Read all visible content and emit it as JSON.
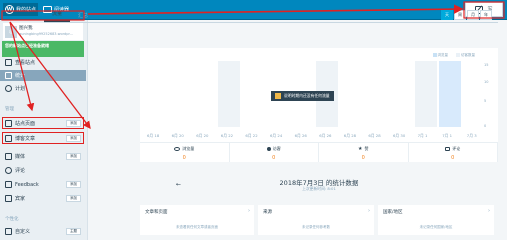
{
  "masterbar": {
    "my_sites_label": "我的站点",
    "reader_label": "阅读器",
    "write_label": "写"
  },
  "sidebar": {
    "site_name": "图兴我",
    "site_url": "quningbing99252683.wordpr...",
    "notice_title": "您的新站点已经准备就绪",
    "notice_sub": "",
    "items": [
      {
        "label": "查看站点"
      },
      {
        "label": "统计"
      },
      {
        "label": "计划"
      }
    ],
    "manage_label": "管理",
    "manage_items": [
      {
        "label": "站点页面",
        "add": "添加"
      },
      {
        "label": "博客文章",
        "add": "添加"
      },
      {
        "label": "媒体",
        "add": "添加"
      },
      {
        "label": "评论"
      },
      {
        "label": "Feedback",
        "add": "添加"
      },
      {
        "label": "宾家",
        "add": "添加"
      }
    ],
    "personalize_label": "个性化",
    "personalize_items": [
      {
        "label": "自定义",
        "add": "主题"
      }
    ]
  },
  "main": {
    "tabs": [
      {
        "label": "流量"
      },
      {
        "label": "汇总"
      }
    ],
    "period": [
      "天",
      "周",
      "月",
      "年"
    ],
    "legend": [
      {
        "label": "浏览量",
        "color": "#c8e1f5"
      },
      {
        "label": "访客数量",
        "color": "#eaf1f7"
      }
    ],
    "yaxis": [
      "15",
      "10",
      "5",
      "0"
    ],
    "tooltip": "说明时期内还没有任何流量",
    "stats": [
      {
        "label": "浏览量",
        "value": "0"
      },
      {
        "label": "访客",
        "value": "0"
      },
      {
        "label": "赞",
        "value": "0"
      },
      {
        "label": "评论",
        "value": "0"
      }
    ],
    "date_title": "2018年7月3日 的统计数据",
    "date_sub": "上次更新时间: 8:01",
    "cards": [
      {
        "title": "文章和页面",
        "msg": "未查看到任何文章或者页面"
      },
      {
        "title": "来源",
        "msg": "未记录任何参考数"
      },
      {
        "title": "国家/地区",
        "msg": "未记录任何国家/地区"
      }
    ]
  },
  "chart_data": {
    "type": "bar",
    "categories": [
      "6月 18",
      "6月 20",
      "6月 20",
      "6月 22",
      "6月 22",
      "6月 24",
      "6月 26",
      "6月 26",
      "6月 28",
      "6月 28",
      "6月 30",
      "7月 1",
      "7月 1",
      "7月 3"
    ],
    "series": [
      {
        "name": "浏览量",
        "values": [
          0,
          0,
          0,
          0,
          0,
          0,
          0,
          0,
          0,
          0,
          0,
          0,
          0,
          0
        ]
      },
      {
        "name": "访客数量",
        "values": [
          0,
          0,
          0,
          0,
          0,
          0,
          0,
          0,
          0,
          0,
          0,
          0,
          0,
          0
        ]
      }
    ],
    "ylim": [
      0,
      15
    ],
    "yticks": [
      0,
      5,
      10,
      15
    ]
  }
}
